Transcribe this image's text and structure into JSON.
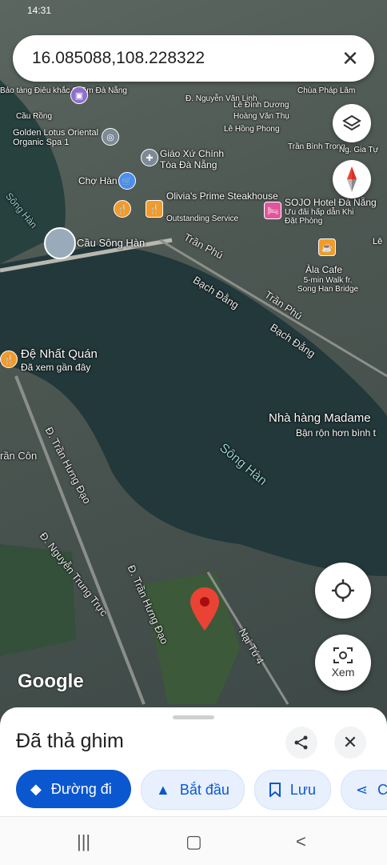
{
  "statusbar": {
    "time": "14:31",
    "right": ""
  },
  "search": {
    "query": "16.085088,108.228322"
  },
  "map_labels": {
    "bao_tang": "Bảo tàng Điêu khắc Chăm Đà Nẵng",
    "cau_rong": "Cầu Rồng",
    "golden_lotus": "Golden Lotus Oriental Organic Spa 1",
    "cho_han": "Chợ Hàn",
    "giao_xu": "Giáo Xứ Chính Tòa Đà Nẵng",
    "olivias": "Olivia's Prime Steakhouse",
    "olivias_sub": "Outstanding Service",
    "sojo": "SOJO Hotel Đà Nẵng",
    "sojo_sub": "Ưu đãi hấp dẫn Khi Đặt Phòng",
    "chua": "Chùa Pháp Lâm",
    "nguyen_van_linh": "Đ. Nguyễn Văn Linh",
    "le_dinh_duong": "Lê Đình Dương",
    "hoang_van_thu": "Hoàng Văn Thụ",
    "le_hong_phong": "Lê Hồng Phong",
    "tran_binh_trong": "Trần Bình Trọng",
    "ng_gia_tu": "Ng. Gia Tự",
    "cau_song_han": "Cầu Sông Hàn",
    "tran_phu": "Trần Phú",
    "bach_dang": "Bạch Đằng",
    "tran_phu2": "Trần Phú",
    "bach_dang2": "Bạch Đằng",
    "ala_cafe": "Àla Cafe",
    "ala_sub": "5-min Walk fr. Song Han Bridge",
    "de_nhat": "Đệ Nhất Quán",
    "de_nhat_sub": "Đã xem gần đây",
    "madame": "Nhà hàng Madame",
    "madame_sub": "Bận rộn hơn bình t",
    "song_han_river": "Sông Hàn",
    "song_han_left": "Sông Hàn",
    "tran_hung_dao": "Đ. Trần Hưng Đạo",
    "tran_hung_dao2": "Đ. Trần Hưng Đạo",
    "tran_con": "rần Côn",
    "nguyen_trung_truc": "Đ. Nguyễn Trung Trực",
    "nai_tu": "Nại Tú 4",
    "le": "Lê"
  },
  "buttons": {
    "xem": "Xem"
  },
  "google": "Google",
  "sheet": {
    "title": "Đã thả ghim",
    "chips": [
      "Đường đi",
      "Bắt đầu",
      "Lưu",
      "C"
    ]
  },
  "colors": {
    "accent": "#0b57d0",
    "pin": "#ea4335"
  }
}
